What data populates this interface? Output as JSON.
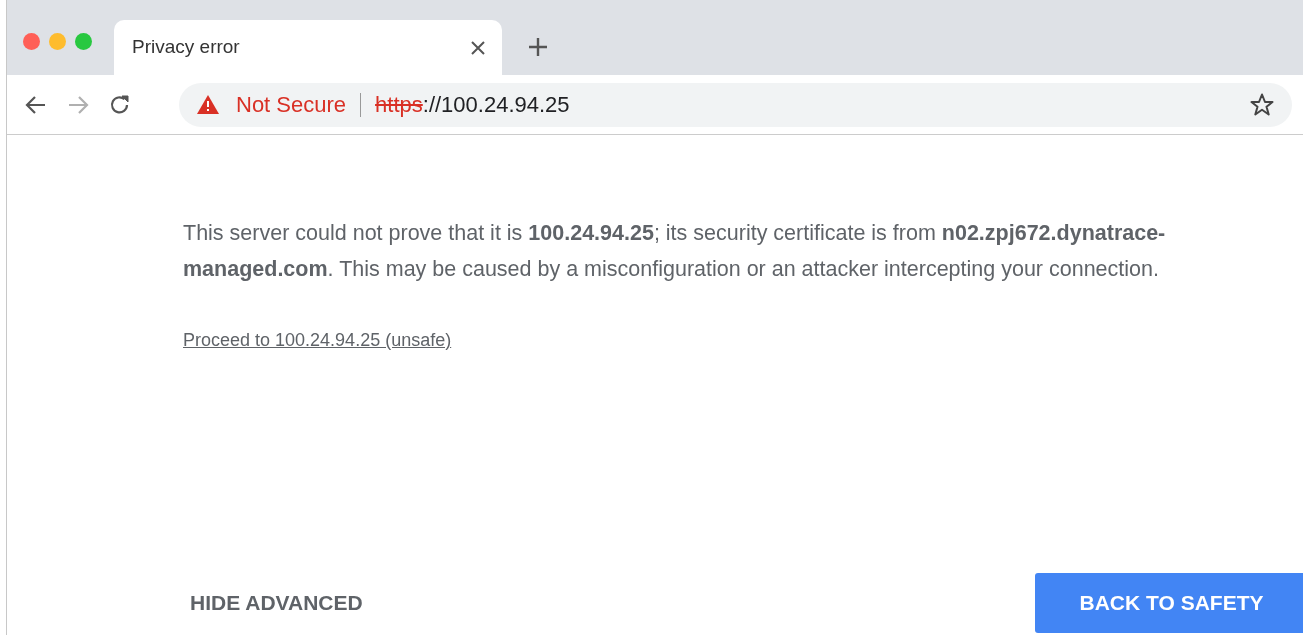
{
  "tab": {
    "title": "Privacy error",
    "selected": true
  },
  "nav": [
    {
      "kind": "back",
      "disabled": false
    },
    {
      "kind": "forward",
      "disabled": true
    },
    {
      "kind": "reload",
      "disabled": false
    }
  ],
  "address_bar": {
    "security_label": "Not Secure",
    "scheme": "https",
    "rest": "://100.24.94.25"
  },
  "message": "This server could not prove that it is **100.24.94.25**; its security certificate is from **n02.zpj672.dynatrace-managed.com**. This may be caused by a misconfiguration or an attacker intercepting your connection.",
  "proceed_link": "Proceed to 100.24.94.25 (unsafe)",
  "buttons": [
    {
      "kind": "text",
      "label": "HIDE ADVANCED"
    },
    {
      "kind": "primary",
      "label": "BACK TO SAFETY"
    }
  ]
}
